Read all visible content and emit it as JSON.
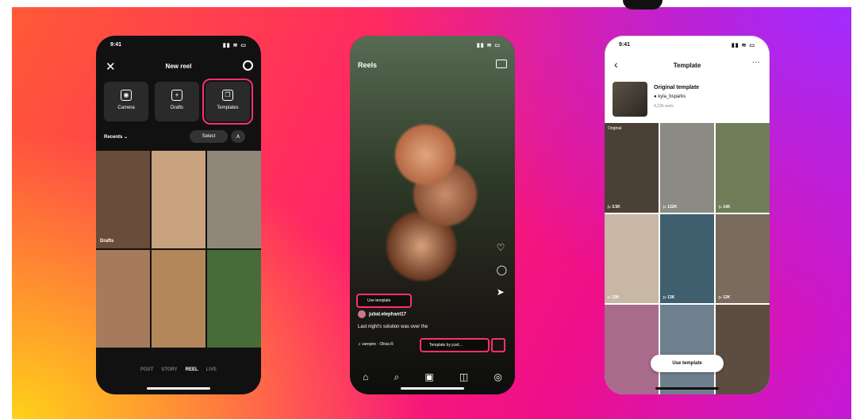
{
  "phone1": {
    "status": {
      "time": "9:41",
      "signal": "▮▮ ≋ ▭"
    },
    "header": {
      "close_icon": "✕",
      "title": "New reel"
    },
    "tiles": [
      {
        "icon": "◉",
        "label": "Camera"
      },
      {
        "icon": "+",
        "label": "Drafts"
      },
      {
        "icon": "❐",
        "label": "Templates"
      }
    ],
    "recents_label": "Recents ⌄",
    "select_label": "Select",
    "grid_cells": [
      {
        "color": "#6a4c3a",
        "label": "Drafts"
      },
      {
        "color": "#c9a27f",
        "label": ""
      },
      {
        "color": "#8f8778",
        "label": ""
      },
      {
        "color": "#a57a5d",
        "label": ""
      },
      {
        "color": "#b4875a",
        "label": ""
      },
      {
        "color": "#486b3a",
        "label": ""
      }
    ],
    "modes": [
      "POST",
      "STORY",
      "REEL",
      "LIVE"
    ]
  },
  "phone2": {
    "status": {
      "time": "",
      "signal": "▮▮ ≋ ▭"
    },
    "title": "Reels",
    "use_template": "Use template",
    "username": "jubal.elephant17",
    "caption": "Last night's solution was over the",
    "audio": "♫ vampire · Olivia R",
    "template_by": "Template by jcarl...",
    "side_icons": [
      "♡",
      "◯",
      "➤"
    ],
    "tab_icons": [
      "⌂",
      "⌕",
      "▣",
      "◫",
      "◎"
    ]
  },
  "phone3": {
    "status": {
      "time": "9:41",
      "signal": "▮▮ ≋ ▭"
    },
    "header": {
      "back": "‹",
      "title": "Template",
      "more": "···"
    },
    "original_template": "Original template",
    "handle": "● kyla_bsparks",
    "reels_count": "4,236 reels",
    "cells": [
      {
        "color": "#4a4035",
        "count": "▷ 3.5K",
        "orig": "Original"
      },
      {
        "color": "#8c8a85",
        "count": "▷ 132K",
        "orig": ""
      },
      {
        "color": "#6f7d58",
        "count": "▷ 14K",
        "orig": ""
      },
      {
        "color": "#c9b7a5",
        "count": "▷ 13K",
        "orig": ""
      },
      {
        "color": "#3f5f6e",
        "count": "▷ 13K",
        "orig": ""
      },
      {
        "color": "#7a6b5d",
        "count": "▷ 12K",
        "orig": ""
      },
      {
        "color": "#a86b8c",
        "count": "",
        "orig": ""
      },
      {
        "color": "#6e7f8d",
        "count": "",
        "orig": ""
      },
      {
        "color": "#5c4d40",
        "count": "",
        "orig": ""
      }
    ],
    "use_template": "Use template"
  }
}
